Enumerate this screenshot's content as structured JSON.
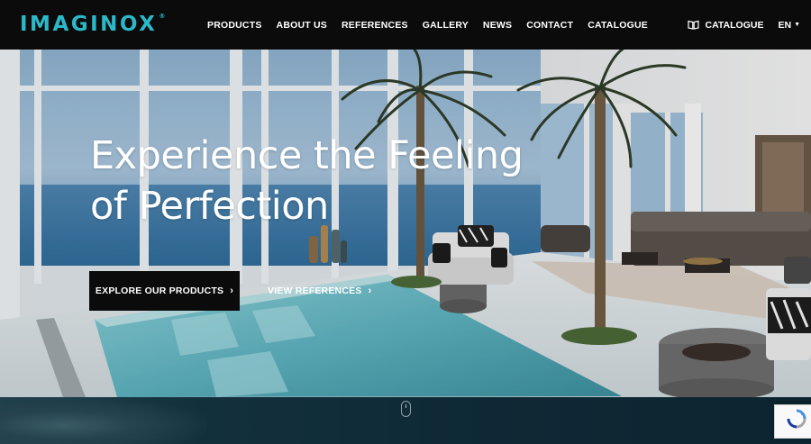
{
  "brand": {
    "name": "IMAGINOX",
    "mark": "®",
    "color": "#2bb8c8"
  },
  "nav": {
    "items": [
      "PRODUCTS",
      "ABOUT US",
      "REFERENCES",
      "GALLERY",
      "NEWS",
      "CONTACT",
      "CATALOGUE"
    ]
  },
  "tools": {
    "catalogue_label": "CATALOGUE",
    "catalogue_icon": "open-book-icon",
    "language": "EN"
  },
  "hero": {
    "title_line1": "Experience the Feeling",
    "title_line2": "of Perfection",
    "primary_cta": "EXPLORE OUR PRODUCTS",
    "secondary_cta": "VIEW REFERENCES"
  },
  "colors": {
    "header_bg": "#0b0b0b",
    "accent": "#2bb8c8",
    "button_bg": "#0b0b0b"
  }
}
